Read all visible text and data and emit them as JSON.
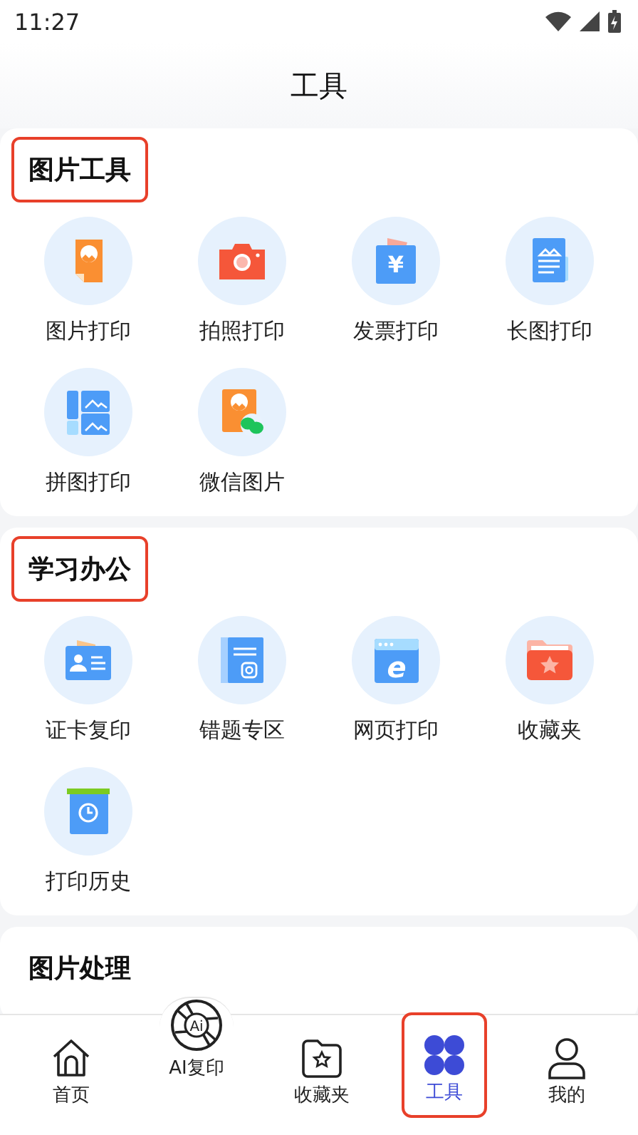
{
  "status_bar": {
    "time": "11:27"
  },
  "header": {
    "title": "工具"
  },
  "sections": [
    {
      "title": "图片工具",
      "highlighted": true,
      "items": [
        {
          "label": "图片打印"
        },
        {
          "label": "拍照打印"
        },
        {
          "label": "发票打印",
          "glyph": "¥"
        },
        {
          "label": "长图打印"
        },
        {
          "label": "拼图打印"
        },
        {
          "label": "微信图片"
        }
      ]
    },
    {
      "title": "学习办公",
      "highlighted": true,
      "items": [
        {
          "label": "证卡复印"
        },
        {
          "label": "错题专区"
        },
        {
          "label": "网页打印",
          "glyph": "e"
        },
        {
          "label": "收藏夹"
        },
        {
          "label": "打印历史"
        }
      ]
    },
    {
      "title": "图片处理",
      "highlighted": false
    }
  ],
  "tabs": [
    {
      "label": "首页",
      "selected": false,
      "highlighted": false
    },
    {
      "label": "AI复印",
      "selected": false,
      "highlighted": false,
      "glyph": "Ai"
    },
    {
      "label": "收藏夹",
      "selected": false,
      "highlighted": false
    },
    {
      "label": "工具",
      "selected": true,
      "highlighted": true
    },
    {
      "label": "我的",
      "selected": false,
      "highlighted": false
    }
  ]
}
